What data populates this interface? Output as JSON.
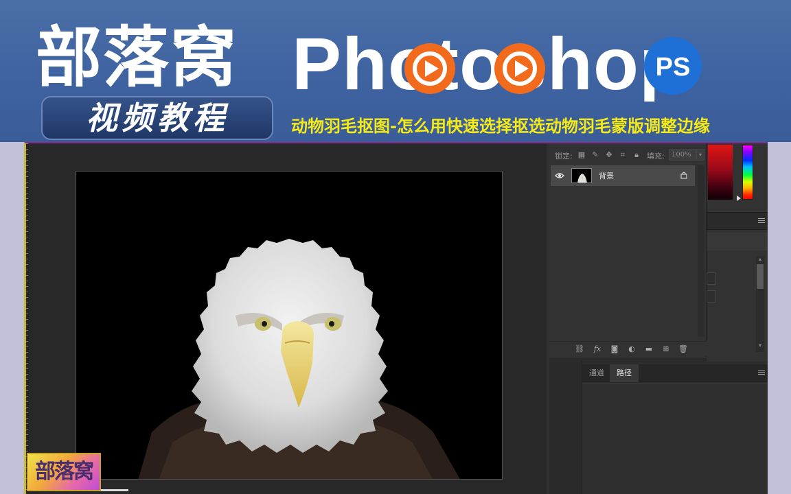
{
  "banner": {
    "brand_cn": "部落窝",
    "video_badge": "视频教程",
    "ps_word": "Photoshop",
    "ps_badge": "PS",
    "tutorial_title": "动物羽毛抠图-怎么用快速选择抠选动物羽毛蒙版调整边缘"
  },
  "layers": {
    "lock_label": "锁定:",
    "fill_label": "填充:",
    "fill_value": "100%",
    "items": [
      {
        "name": "背景",
        "visible": true,
        "locked": true
      }
    ],
    "footer_icons": [
      "link-icon",
      "fx-icon",
      "mask-icon",
      "adjustment-icon",
      "folder-icon",
      "new-layer-icon",
      "trash-icon"
    ]
  },
  "paths_panel": {
    "tabs": [
      {
        "label": "通道",
        "active": false
      },
      {
        "label": "路径",
        "active": true
      }
    ]
  },
  "watermark": {
    "text": "部落窝"
  },
  "colors": {
    "banner_blue": "#3e62a0",
    "title_yellow": "#f5ea16",
    "ps_orange": "#f26a1b",
    "ps_badge_blue": "#1e6fd6",
    "foreground": "#e01515"
  }
}
